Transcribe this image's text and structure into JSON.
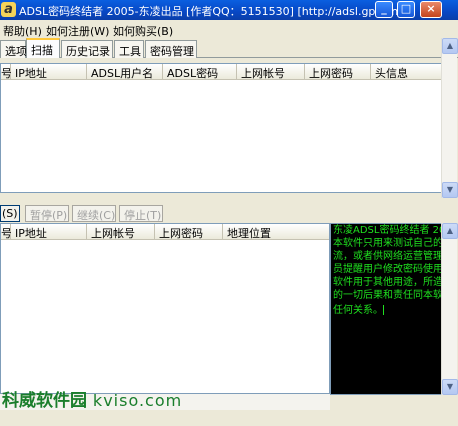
{
  "window": {
    "title": "ADSL密码终结者 2005-东凌出品 [作者QQ：5151530] [http://adsl.gpzx.net]",
    "icon_glyph": "a",
    "controls": {
      "minimize": "_",
      "maximize": "□",
      "close": "×"
    }
  },
  "menu": [
    "帮助(H)",
    "如何注册(W)",
    "如何购买(B)"
  ],
  "tabs": [
    "选项",
    "扫描",
    "历史记录",
    "工具",
    "密码管理"
  ],
  "active_tab": "扫描",
  "top_table": {
    "columns": [
      "号",
      "IP地址",
      "ADSL用户名",
      "ADSL密码",
      "上网帐号",
      "上网密码",
      "头信息"
    ]
  },
  "toolbar": [
    "(S)",
    "暂停(P)",
    "继续(C)",
    "停止(T)"
  ],
  "bottom_table": {
    "columns": [
      "号",
      "IP地址",
      "上网帐号",
      "上网密码",
      "地理位置"
    ]
  },
  "console": {
    "lines": [
      "东凌ADSL密码终结者 20",
      "本软件只用来测试自己的",
      "流，或者供网络运营管理",
      "员提醒用户修改密码使用",
      "软件用于其他用途，所造",
      "的一切后果和责任同本软",
      "任何关系。"
    ]
  },
  "watermark": {
    "text": "科威软件园",
    "url": "kviso.com"
  },
  "scroll_arrows": {
    "up": "▲",
    "down": "▼"
  }
}
